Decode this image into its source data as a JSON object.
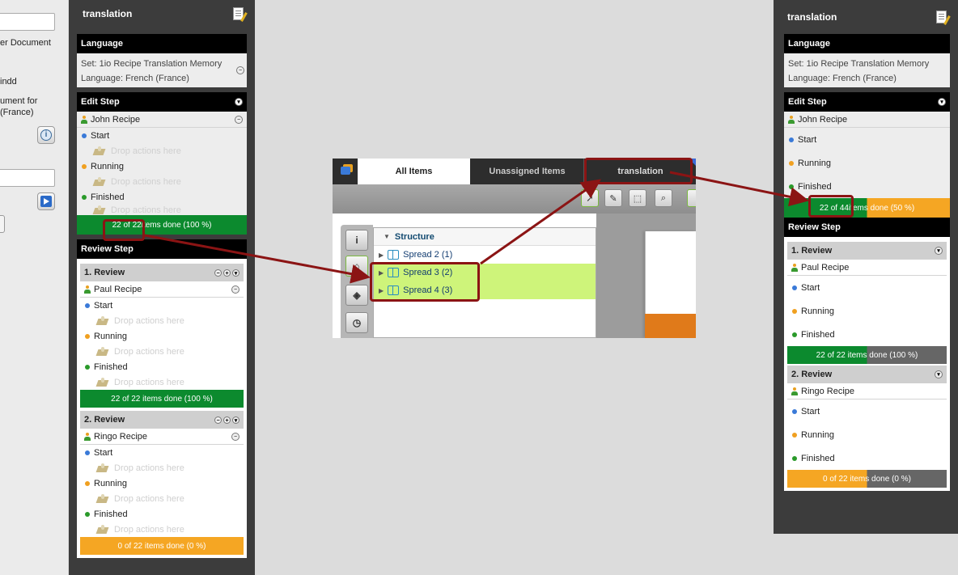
{
  "left_doc": {
    "text_line1": "er Document",
    "text_line2": "indd",
    "text_line3": "ument for",
    "text_line4": "(France)"
  },
  "left_panel": {
    "title": "translation",
    "language": {
      "header": "Language",
      "set": "Set: 1io Recipe Translation Memory",
      "language": "Language: French (France)"
    },
    "edit_step": {
      "header": "Edit Step",
      "user": "John Recipe",
      "steps": [
        "Start",
        "Running",
        "Finished"
      ],
      "drop_text": "Drop actions here",
      "bar_highlight": "22 of 22",
      "bar_rest": " items done (100 %)"
    },
    "review_step": {
      "header": "Review Step",
      "reviews": [
        {
          "title": "1. Review",
          "user": "Paul Recipe",
          "steps": [
            "Start",
            "Running",
            "Finished"
          ],
          "bar": "22 of 22 items done (100 %)",
          "bar_color": "green"
        },
        {
          "title": "2. Review",
          "user": "Ringo Recipe",
          "steps": [
            "Start",
            "Running",
            "Finished"
          ],
          "bar": "0 of 22 items done (0 %)",
          "bar_color": "orange"
        }
      ]
    }
  },
  "center_shot": {
    "tabs": [
      "All Items",
      "Unassigned Items",
      "translation"
    ],
    "tree": {
      "header": "Structure",
      "rows": [
        "Spread 2 (1)",
        "Spread 3 (2)",
        "Spread 4 (3)"
      ]
    }
  },
  "right_panel": {
    "title": "translation",
    "language": {
      "header": "Language",
      "set": "Set: 1io Recipe Translation Memory",
      "language": "Language: French (France)"
    },
    "edit_step": {
      "header": "Edit Step",
      "user": "John Recipe",
      "steps": [
        "Start",
        "Running",
        "Finished"
      ],
      "bar_highlight": "22 of 44",
      "bar_rest": " items done (50 %)"
    },
    "review_step": {
      "header": "Review Step",
      "reviews": [
        {
          "title": "1. Review",
          "user": "Paul Recipe",
          "steps": [
            "Start",
            "Running",
            "Finished"
          ],
          "bar": "22 of 22 items done (100 %)"
        },
        {
          "title": "2. Review",
          "user": "Ringo Recipe",
          "steps": [
            "Start",
            "Running",
            "Finished"
          ],
          "bar": "0 of 22 items done (0 %)"
        }
      ]
    }
  },
  "colors": {
    "done_green": "#0c8a2e",
    "pending_orange": "#f5a623",
    "remaining_gray": "#666666",
    "highlight_green": "#cef47a",
    "annotation_red": "#8b1414"
  }
}
